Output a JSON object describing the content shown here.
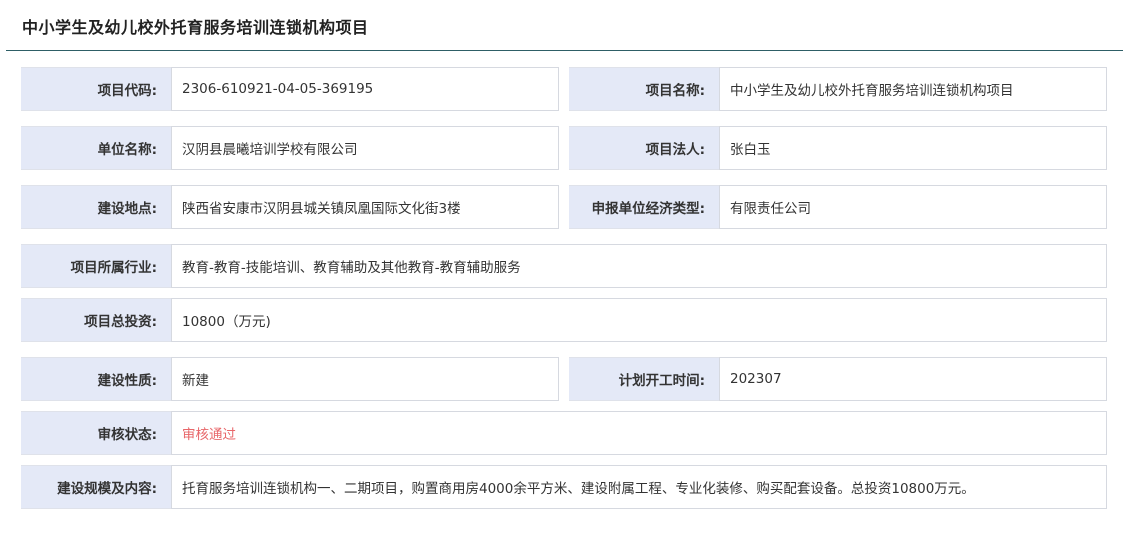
{
  "title": "中小学生及幼儿校外托育服务培训连锁机构项目",
  "rows": [
    {
      "label1": "项目代码:",
      "value1": "2306-610921-04-05-369195",
      "label2": "项目名称:",
      "value2": "中小学生及幼儿校外托育服务培训连锁机构项目"
    },
    {
      "label1": "单位名称:",
      "value1": "汉阴县晨曦培训学校有限公司",
      "label2": "项目法人:",
      "value2": "张白玉"
    },
    {
      "label1": "建设地点:",
      "value1": "陕西省安康市汉阴县城关镇凤凰国际文化街3楼",
      "label2": "申报单位经济类型:",
      "value2": "有限责任公司"
    },
    {
      "label": "项目所属行业:",
      "value": "教育-教育-技能培训、教育辅助及其他教育-教育辅助服务"
    },
    {
      "label": "项目总投资:",
      "value": "10800（万元)"
    },
    {
      "label1": "建设性质:",
      "value1": "新建",
      "label2": "计划开工时间:",
      "value2": "202307"
    },
    {
      "label": "审核状态:",
      "value": "审核通过"
    },
    {
      "label": "建设规模及内容:",
      "value": "托育服务培训连锁机构一、二期项目，购置商用房4000余平方米、建设附属工程、专业化装修、购买配套设备。总投资10800万元。"
    }
  ],
  "colors": {
    "label_bg": "#e4e9f7",
    "status_pass": "#e8676a",
    "header_line": "#2e5e66"
  }
}
